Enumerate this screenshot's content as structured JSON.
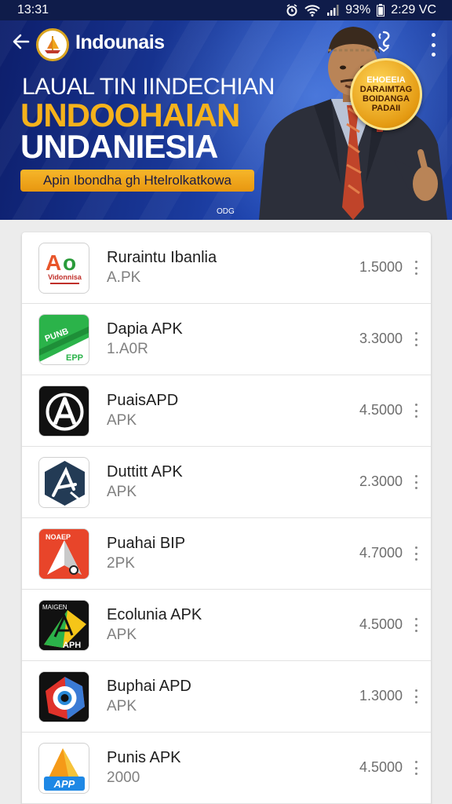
{
  "status_bar": {
    "time": "13:31",
    "battery": "93%",
    "right_text": "2:29 VC",
    "icons": [
      "alarm-icon",
      "wifi-icon",
      "signal-icon",
      "battery-icon"
    ]
  },
  "banner": {
    "app_title": "Indounais",
    "headline_1": "LAUAL TIN IINDECHIAN",
    "headline_2": "UNDOOHAIAN",
    "headline_3": "UNDANIESIA",
    "promo_button": "Apin Ibondha gh Htelrolkatkowa",
    "small_mark": "ODG",
    "badge": [
      "EHOEEIA",
      "DARAIMTAG",
      "BOIDANGA",
      "PADAII"
    ]
  },
  "apps": [
    {
      "name": "Ruraintu Ibanlia",
      "sub": "A.PK",
      "value": "1.5000",
      "icon": "ao-logo-icon",
      "icon_text": "Vidonnisa"
    },
    {
      "name": "Dapia APK",
      "sub": "1.A0R",
      "value": "3.3000",
      "icon": "green-ticket-icon",
      "icon_text": "EPP"
    },
    {
      "name": "PuaisAPD",
      "sub": "APK",
      "value": "4.5000",
      "icon": "circle-a-icon",
      "icon_text": ""
    },
    {
      "name": "Duttitt APK",
      "sub": "APK",
      "value": "2.3000",
      "icon": "hexagon-a-icon",
      "icon_text": ""
    },
    {
      "name": "Puahai BIP",
      "sub": "2PK",
      "value": "4.7000",
      "icon": "arrow-cursor-icon",
      "icon_text": "NOAEP"
    },
    {
      "name": "Ecolunia APK",
      "sub": "APK",
      "value": "4.5000",
      "icon": "apk-a-icon",
      "icon_text": "APH"
    },
    {
      "name": "Buphai APD",
      "sub": "APK",
      "value": "1.3000",
      "icon": "eye-badge-icon",
      "icon_text": ""
    },
    {
      "name": "Punis APK",
      "sub": "2000",
      "value": "4.5000",
      "icon": "app-a-icon",
      "icon_text": "APP"
    }
  ],
  "colors": {
    "banner_dark": "#0d1e6b",
    "accent_gold": "#f5b21c",
    "row_text": "#1e1e1e",
    "row_secondary": "#808080"
  }
}
